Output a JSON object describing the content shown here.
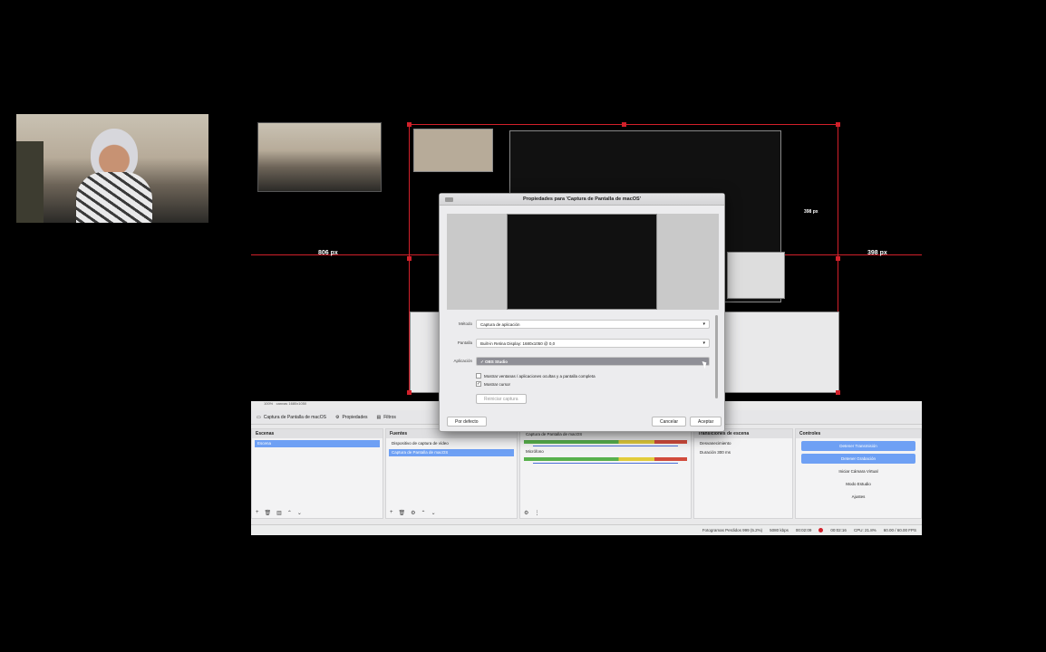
{
  "preview": {
    "left_distance": "806 px",
    "right_distance": "398 px",
    "inner_distance": "398 px",
    "zoom": "100%",
    "status": "canvas 1680x1050"
  },
  "toolbar": {
    "source_name": "Captura de Pantalla de macOS",
    "properties_label": "Propiedades",
    "filters_label": "Filtros"
  },
  "dialog": {
    "title": "Propiedades para 'Captura de Pantalla de macOS'",
    "method_label": "Método",
    "method_value": "Captura de aplicación",
    "screen_label": "Pantalla",
    "screen_value": "Built-in Retina Display: 1680x1050 @ 0,0",
    "app_label": "Aplicación",
    "app_value": "✓ OBS Studio",
    "show_hidden_label": "Mostrar ventanas / aplicaciones ocultas y a pantalla completa",
    "show_cursor_label": "Mostrar cursor",
    "restart_label": "Reiniciar captura",
    "defaults_button": "Por defecto",
    "cancel_button": "Cancelar",
    "accept_button": "Aceptar"
  },
  "scenes": {
    "title": "Escenas",
    "items": [
      "Escena"
    ]
  },
  "sources": {
    "title": "Fuentes",
    "items": [
      "Dispositivo de captura de vídeo",
      "Captura de Pantalla de macOS"
    ]
  },
  "mixer": {
    "channels": [
      {
        "name": "Captura de Pantalla de macOS",
        "level": "0.0 dB"
      },
      {
        "name": "Micrófono",
        "level": "0.0 dB"
      }
    ]
  },
  "transitions": {
    "title": "Transiciones de escena",
    "type": "Desvanecimiento",
    "duration_label": "Duración",
    "duration_value": "300 ms"
  },
  "controls": {
    "title": "Controles",
    "buttons": [
      "Detener Transmisión",
      "Detener Grabación",
      "Iniciar Cámara Virtual",
      "Modo Estudio",
      "Ajustes"
    ]
  },
  "status": {
    "dropped": "Fotogramas Perdidos 999 (5.2%)",
    "bitrate": "5080 kbps",
    "stream_time": "00:02:09",
    "rec_time": "00:02:16",
    "cpu": "CPU: 21.8%",
    "fps": "60.00 / 60.00 FPS"
  },
  "colors": {
    "accent": "#6ea0f4",
    "guide_red": "#d2202a"
  }
}
